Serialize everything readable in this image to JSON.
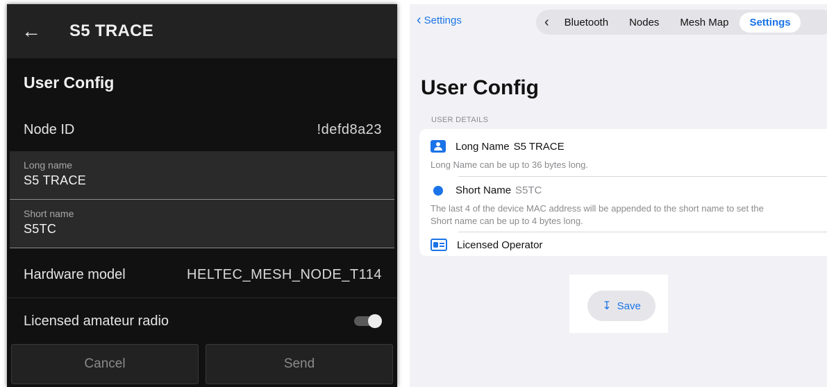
{
  "android": {
    "app_title": "S5 TRACE",
    "section_title": "User Config",
    "node_id": {
      "label": "Node ID",
      "value": "!defd8a23"
    },
    "long_name": {
      "label": "Long name",
      "value": "S5 TRACE"
    },
    "short_name": {
      "label": "Short name",
      "value": "S5TC"
    },
    "hardware_model": {
      "label": "Hardware model",
      "value": "HELTEC_MESH_NODE_T114"
    },
    "licensed": {
      "label": "Licensed amateur radio",
      "enabled": false
    },
    "buttons": {
      "cancel": "Cancel",
      "send": "Send"
    },
    "colors": {
      "background": "#111111",
      "appbar": "#222222",
      "field": "#2a2a2a"
    }
  },
  "ios": {
    "back_link": "Settings",
    "tabs": [
      "Bluetooth",
      "Nodes",
      "Mesh Map",
      "Settings"
    ],
    "active_tab": "Settings",
    "page_title": "User Config",
    "group_header": "USER DETAILS",
    "long_name": {
      "label": "Long Name",
      "value": "S5 TRACE",
      "hint": "Long Name can be up to 36 bytes long."
    },
    "short_name": {
      "label": "Short Name",
      "value": "S5TC",
      "hint_1": "The last 4 of the device MAC address will be appended to the short name to set the",
      "hint_2": "Short name can be up to 4 bytes long."
    },
    "licensed_operator": {
      "label": "Licensed Operator"
    },
    "save_label": "Save",
    "colors": {
      "accent": "#1a73e8",
      "background": "#f2f2f6"
    }
  }
}
